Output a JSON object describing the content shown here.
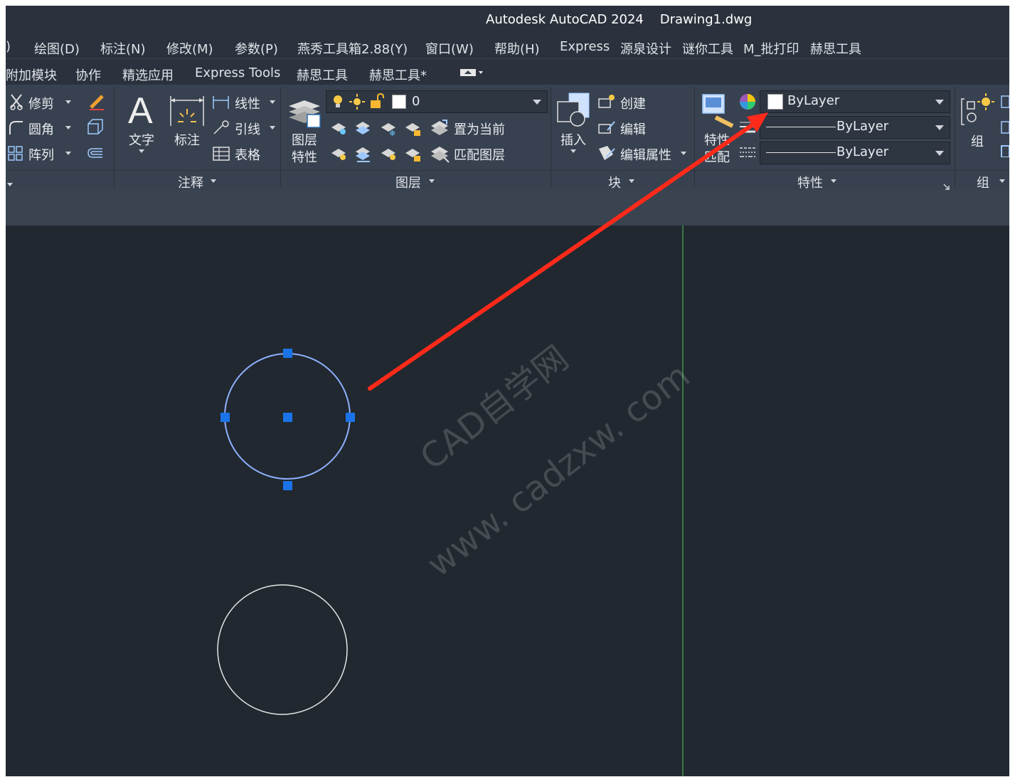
{
  "title": "Autodesk AutoCAD 2024    Drawing1.dwg",
  "menu": [
    "绘图(D)",
    "标注(N)",
    "修改(M)",
    "参数(P)",
    "燕秀工具箱2.88(Y)",
    "窗口(W)",
    "帮助(H)",
    "Express",
    "源泉设计",
    "谜你工具",
    "M_批打印",
    "赫思工具"
  ],
  "menu_partial": ")",
  "tabs": [
    "附加模块",
    "协作",
    "精选应用",
    "Express Tools",
    "赫思工具",
    "赫思工具*"
  ],
  "modify": {
    "trim": "修剪",
    "fillet": "圆角",
    "array": "阵列"
  },
  "annotation": {
    "text": "文字",
    "dim": "标注",
    "linear": "线性",
    "leader": "引线",
    "table": "表格",
    "panel": "注释"
  },
  "layers": {
    "current": "0",
    "props1": "图层",
    "props2": "特性",
    "set_current": "置为当前",
    "match": "匹配图层",
    "panel": "图层"
  },
  "block": {
    "insert": "插入",
    "create": "创建",
    "edit": "编辑",
    "edit_attr": "编辑属性",
    "panel": "块"
  },
  "properties": {
    "match1": "特性",
    "match2": "匹配",
    "color": "ByLayer",
    "linetype": "ByLayer",
    "lineweight": "ByLayer",
    "panel": "特性"
  },
  "group": {
    "label": "组",
    "panel": "组"
  },
  "watermark": {
    "line1": "CAD自学网",
    "line2": "www. cadzxw. com"
  },
  "colors": {
    "arrow": "#ff2a1a",
    "grip": "#1a73e8",
    "selected": "#8fb0ff",
    "crosshair": "#4caf50"
  }
}
